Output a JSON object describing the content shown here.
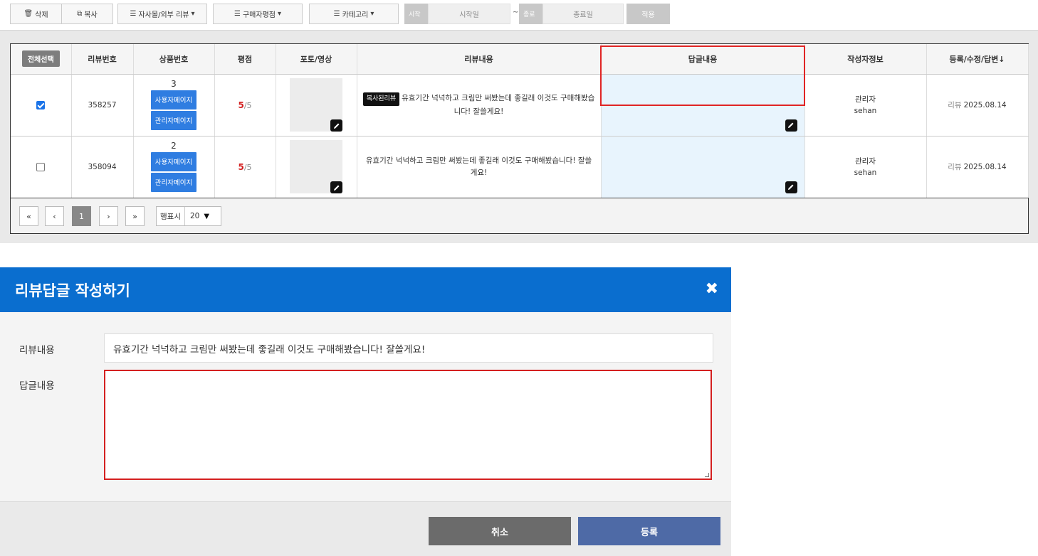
{
  "toolbar": {
    "delete_label": "삭제",
    "copy_label": "복사",
    "filter_review_source": "자사몰/외부 리뷰",
    "filter_rating": "구매자평점",
    "filter_category": "카테고리",
    "start_label": "시작",
    "start_placeholder": "시작일",
    "tilde": "~",
    "end_label": "종료",
    "end_placeholder": "종료일",
    "apply_label": "적용"
  },
  "table": {
    "select_all_label": "전체선택",
    "headers": [
      "리뷰번호",
      "상품번호",
      "평점",
      "포토/영상",
      "리뷰내용",
      "답글내용",
      "작성자정보",
      "등록/수정/답변↓"
    ],
    "rows": [
      {
        "checked": true,
        "review_no": "358257",
        "product_no": "3",
        "user_page_btn": "사용자페이지",
        "admin_page_btn": "관리자페이지",
        "score": "5",
        "score_max": "/5",
        "badge": "복사된리뷰",
        "content": "유효기간 넉넉하고 크림만 써봤는데 좋길래 이것도 구매해봤습니다! 잘쓸게요!",
        "writer_role": "관리자",
        "writer_id": "sehan",
        "date_label": "리뷰",
        "date": "2025.08.14"
      },
      {
        "checked": false,
        "review_no": "358094",
        "product_no": "2",
        "user_page_btn": "사용자페이지",
        "admin_page_btn": "관리자페이지",
        "score": "5",
        "score_max": "/5",
        "badge": "",
        "content": "유효기간 넉넉하고 크림만 써봤는데 좋길래 이것도 구매해봤습니다! 잘쓸게요!",
        "writer_role": "관리자",
        "writer_id": "sehan",
        "date_label": "리뷰",
        "date": "2025.08.14"
      }
    ]
  },
  "pager": {
    "first": "«",
    "prev": "‹",
    "current": "1",
    "next": "›",
    "last": "»",
    "rows_label": "행표시",
    "rows_value": "20"
  },
  "modal": {
    "title": "리뷰답글 작성하기",
    "close_icon": "✖",
    "review_label": "리뷰내용",
    "review_value": "유효기간 넉넉하고 크림만 써봤는데 좋길래 이것도 구매해봤습니다! 잘쓸게요!",
    "reply_label": "답글내용",
    "reply_value": "",
    "cancel_label": "취소",
    "submit_label": "등록"
  },
  "colors": {
    "accent_blue": "#0a6ecf",
    "product_btn_blue": "#2f7de1",
    "highlight_red": "#e02424",
    "submit_blue": "#4e6aa6"
  }
}
